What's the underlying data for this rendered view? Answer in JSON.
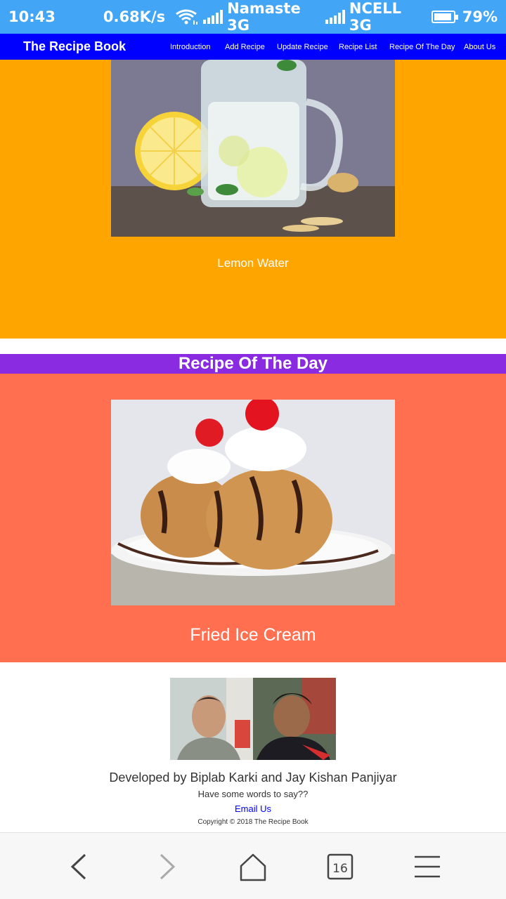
{
  "status_bar": {
    "time": "10:43",
    "speed": "0.68K/s",
    "carrier1": "Namaste 3G",
    "carrier2": "NCELL 3G",
    "battery_pct": "79%",
    "battery_level": 0.79
  },
  "navbar": {
    "brand": "The Recipe Book",
    "links": [
      "Introduction",
      "Add Recipe",
      "Update Recipe",
      "Recipe List",
      "Recipe Of The Day",
      "About Us"
    ],
    "background": "#0000ff"
  },
  "featured": {
    "caption": "Lemon Water",
    "background": "#ffa500"
  },
  "recipe_of_the_day": {
    "heading": "Recipe Of The Day",
    "caption": "Fried Ice Cream",
    "heading_background": "#8a2be2",
    "background": "#ff6f50"
  },
  "footer": {
    "developers": "Developed by Biplab Karki and Jay Kishan Panjiyar",
    "prompt": "Have some words to say??",
    "email_link": "Email Us",
    "copyright": "Copyright © 2018 The Recipe Book"
  },
  "browser_bar": {
    "icons": [
      "back-icon",
      "forward-icon",
      "home-icon",
      "tabs-icon",
      "menu-icon"
    ],
    "tab_count": "16"
  }
}
